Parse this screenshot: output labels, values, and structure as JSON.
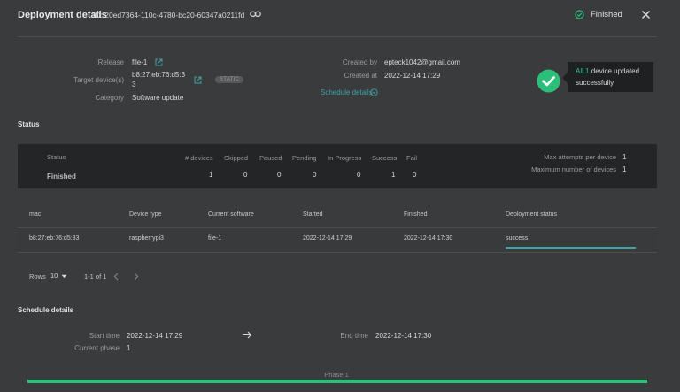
{
  "header": {
    "title": "Deployment details",
    "id_text": "ID: 20ed7364-110c-4780-bc20-60347a0211fd",
    "status": "Finished"
  },
  "overview": {
    "release_label": "Release",
    "release_value": "file-1",
    "target_label": "Target device(s)",
    "target_value_line1": "b8:27:eb:76:d5:3",
    "target_value_line2": "3",
    "badge": "STATIC",
    "category_label": "Category",
    "category_value": "Software update",
    "created_by_label": "Created by",
    "created_by_value": "epteck1042@gmail.com",
    "created_at_label": "Created at",
    "created_at_value": "2022-12-14 17:29",
    "schedule_link": "Schedule details",
    "tooltip_highlight": "All 1",
    "tooltip_rest": "device updated",
    "tooltip_line2": "successfully"
  },
  "status_section": {
    "title": "Status",
    "status_label": "Status",
    "status_value": "Finished",
    "columns": [
      "# devices",
      "Skipped",
      "Paused",
      "Pending",
      "In Progress",
      "Success",
      "Fail"
    ],
    "values": [
      "1",
      "0",
      "0",
      "0",
      "0",
      "1",
      "0"
    ],
    "max_attempts_label": "Max attempts per device",
    "max_attempts_value": "1",
    "max_devices_label": "Maximum number of devices",
    "max_devices_value": "1"
  },
  "table": {
    "headers": [
      "mac",
      "Device type",
      "Current software",
      "Started",
      "Finished",
      "Deployment status"
    ],
    "rows": [
      [
        "b8:27:eb:76:d5:33",
        "raspberrypi3",
        "file-1",
        "2022-12-14 17:29",
        "2022-12-14 17:30",
        "success"
      ]
    ],
    "progress_fraction": 0.85
  },
  "pager": {
    "rows_label": "Rows",
    "rows_value": "10",
    "range": "1-1 of 1"
  },
  "schedule": {
    "title": "Schedule details",
    "start_label": "Start time",
    "start_value": "2022-12-14 17:29",
    "end_label": "End time",
    "end_value": "2022-12-14 17:30",
    "phase_label": "Current phase",
    "phase_value": "1",
    "phase_bar_label": "Phase 1"
  },
  "colors": {
    "background": "#3a3b3d",
    "accent_link": "#3fa3a7",
    "success_green": "#2bc07a",
    "panel": "#242526"
  }
}
